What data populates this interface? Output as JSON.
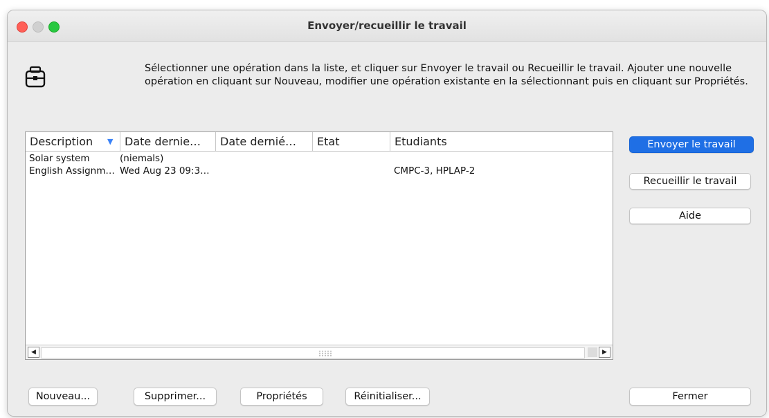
{
  "window": {
    "title": "Envoyer/recueillir le travail"
  },
  "instructions": "Sélectionner une opération dans la liste, et cliquer sur Envoyer le travail ou Recueillir le travail. Ajouter une nouvelle opération en cliquant sur Nouveau, modifier une opération existante en la sélectionnant puis en cliquant sur Propriétés.",
  "table": {
    "columns": [
      "Description",
      "Date dernie…",
      "Date dernié…",
      "Etat",
      "Etudiants"
    ],
    "sorted_column": "Description",
    "rows": [
      [
        "Solar system",
        "(niemals)",
        "",
        "",
        ""
      ],
      [
        "English Assignm…",
        "Wed Aug 23 09:3…",
        "",
        "",
        "CMPC-3, HPLAP-2"
      ]
    ]
  },
  "buttons": {
    "send": "Envoyer le travail",
    "collect": "Recueillir le travail",
    "help": "Aide",
    "new": "Nouveau...",
    "delete": "Supprimer...",
    "properties": "Propriétés",
    "reset": "Réinitialiser...",
    "close": "Fermer"
  },
  "icons": {
    "dialog": "briefcase-icon",
    "sort": "sort-down-icon"
  },
  "colors": {
    "primary_button": "#1f6fe5",
    "sort_indicator": "#3a82f7"
  }
}
